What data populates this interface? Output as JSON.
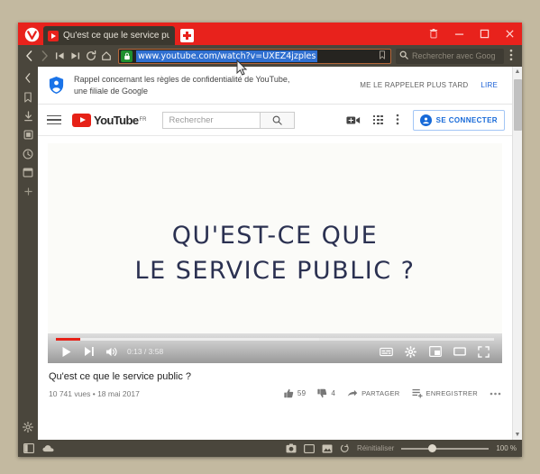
{
  "browser": {
    "name": "Vivaldi",
    "tab": {
      "title": "Qu'est ce que le service pu",
      "favicon": "youtube-favicon"
    },
    "newtab_label": "+",
    "window_controls": [
      {
        "name": "trash-icon",
        "glyph": "Ὕ1"
      },
      {
        "name": "minimize-icon",
        "glyph": "–"
      },
      {
        "name": "maximize-icon",
        "glyph": "□"
      },
      {
        "name": "close-icon",
        "glyph": "×"
      }
    ],
    "nav": {
      "back": "‹",
      "forward": "›",
      "rewind": "⏮",
      "fastforward": "⏭",
      "reload": "⟳",
      "home": "⌂"
    },
    "address": {
      "url": "www.youtube.com/watch?v=UXEZ4jzples",
      "security": "secure-lock",
      "bookmark_icon": "bookmark-outline"
    },
    "search": {
      "placeholder": "Rechercher avec Goog",
      "engine_icon": "google-search-icon"
    },
    "menu_icon": "vertical-dots-icon",
    "panel_items": [
      {
        "name": "panel-collapse",
        "icon": "chevron-left-icon"
      },
      {
        "name": "panel-bookmarks",
        "icon": "bookmark-icon"
      },
      {
        "name": "panel-downloads",
        "icon": "download-icon"
      },
      {
        "name": "panel-notes",
        "icon": "notes-icon"
      },
      {
        "name": "panel-history",
        "icon": "clock-icon"
      },
      {
        "name": "panel-windows",
        "icon": "window-icon"
      },
      {
        "name": "panel-add",
        "icon": "plus-icon"
      },
      {
        "name": "panel-settings",
        "icon": "gear-icon"
      }
    ],
    "statusbar": {
      "panel_toggle_icon": "panel-toggle-icon",
      "cloud_icon": "cloud-icon",
      "capture_icon": "camera-icon",
      "tiling_icon": "tile-icon",
      "images_icon": "image-icon",
      "animation_icon": "animation-icon",
      "reset_label": "Réinitialiser",
      "zoom_level": "100 %",
      "zoom_value": 100
    }
  },
  "page": {
    "privacy_banner": {
      "icon": "privacy-shield-icon",
      "text": "Rappel concernant les règles de confidentialité de YouTube, une filiale de Google",
      "later_label": "ME LE RAPPELER PLUS TARD",
      "read_label": "LIRE"
    },
    "youtube_header": {
      "menu_icon": "hamburger-icon",
      "logo_text": "YouTube",
      "country_code": "FR",
      "search_placeholder": "Rechercher",
      "search_icon": "search-icon",
      "create_icon": "video-camera-icon",
      "apps_icon": "apps-grid-icon",
      "more_icon": "vertical-dots-icon",
      "signin_label": "SE CONNECTER",
      "signin_avatar_icon": "account-circle-icon"
    },
    "video": {
      "thumbnail_line1": "QU'EST-CE QUE",
      "thumbnail_line2": "LE SERVICE PUBLIC ?",
      "title": "Qu'est ce que le service public ?",
      "views": "10 741 vues",
      "date": "18 mai 2017",
      "meta_separator": "•",
      "likes": "59",
      "dislikes": "4",
      "share_label": "PARTAGER",
      "save_label": "ENREGISTRER",
      "more_label": "…",
      "player": {
        "play_icon": "play-icon",
        "next_icon": "next-video-icon",
        "volume_icon": "volume-icon",
        "current_time": "0:13",
        "total_time": "3:58",
        "time_display": "0:13 / 3:58",
        "subtitles_icon": "subtitles-icon",
        "settings_icon": "gear-icon",
        "miniplayer_icon": "miniplayer-icon",
        "theater_icon": "theater-mode-icon",
        "fullscreen_icon": "fullscreen-icon",
        "progress_percent": 5.5
      }
    }
  },
  "colors": {
    "brand_red": "#e8221c",
    "youtube_red": "#e62117",
    "chrome_dark": "#4a463c",
    "link_blue": "#1c62d6",
    "thumb_navy": "#2b3151",
    "desktop": "#c3b9a0"
  }
}
